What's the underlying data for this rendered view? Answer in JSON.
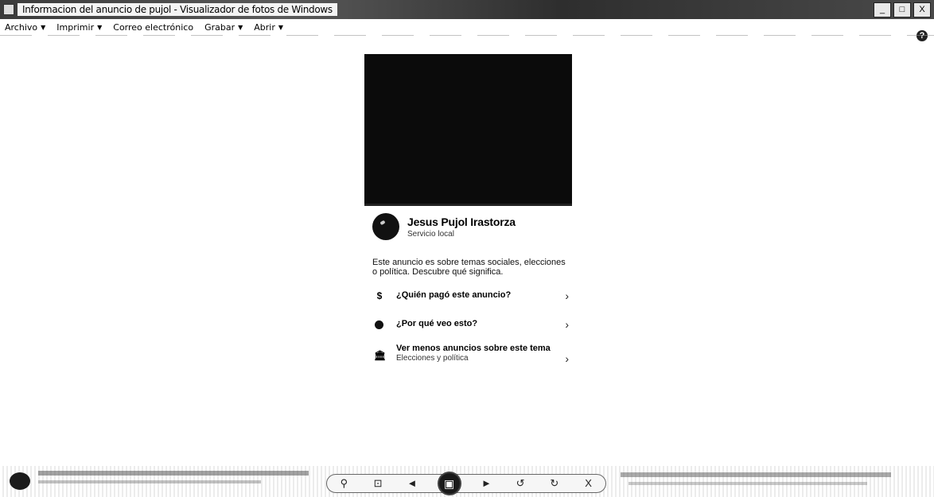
{
  "window": {
    "title": "Informacion del anuncio de pujol - Visualizador de fotos de Windows",
    "controls": [
      "_",
      "□",
      "X"
    ]
  },
  "menu": {
    "items": [
      {
        "label": "Archivo",
        "caret": "▼"
      },
      {
        "label": "Imprimir",
        "caret": "▼"
      },
      {
        "label": "Correo electrónico",
        "caret": ""
      },
      {
        "label": "Grabar",
        "caret": "▼"
      },
      {
        "label": "Abrir",
        "caret": "▼"
      }
    ],
    "help": "?"
  },
  "ad": {
    "page_name": "Jesus Pujol Irastorza",
    "page_category": "Servicio local",
    "disclaimer": "Este anuncio es sobre temas sociales, elecciones o política. Descubre qué significa.",
    "options": [
      {
        "icon": "$",
        "icon_name": "dollar-icon",
        "label": "¿Quién pagó este anuncio?",
        "sub": ""
      },
      {
        "icon": "●",
        "icon_name": "info-dot-icon",
        "label": "¿Por qué veo esto?",
        "sub": ""
      },
      {
        "icon": "🏛",
        "icon_name": "institution-icon",
        "label": "Ver menos anuncios sobre este tema",
        "sub": "Elecciones y política"
      }
    ],
    "chevron": "›"
  },
  "toolbar": {
    "zoom": "⚲",
    "fit": "⊡",
    "prev": "◄",
    "slideshow": "▣",
    "next": "►",
    "rotate_ccw": "↺",
    "rotate_cw": "↻",
    "delete": "X"
  }
}
